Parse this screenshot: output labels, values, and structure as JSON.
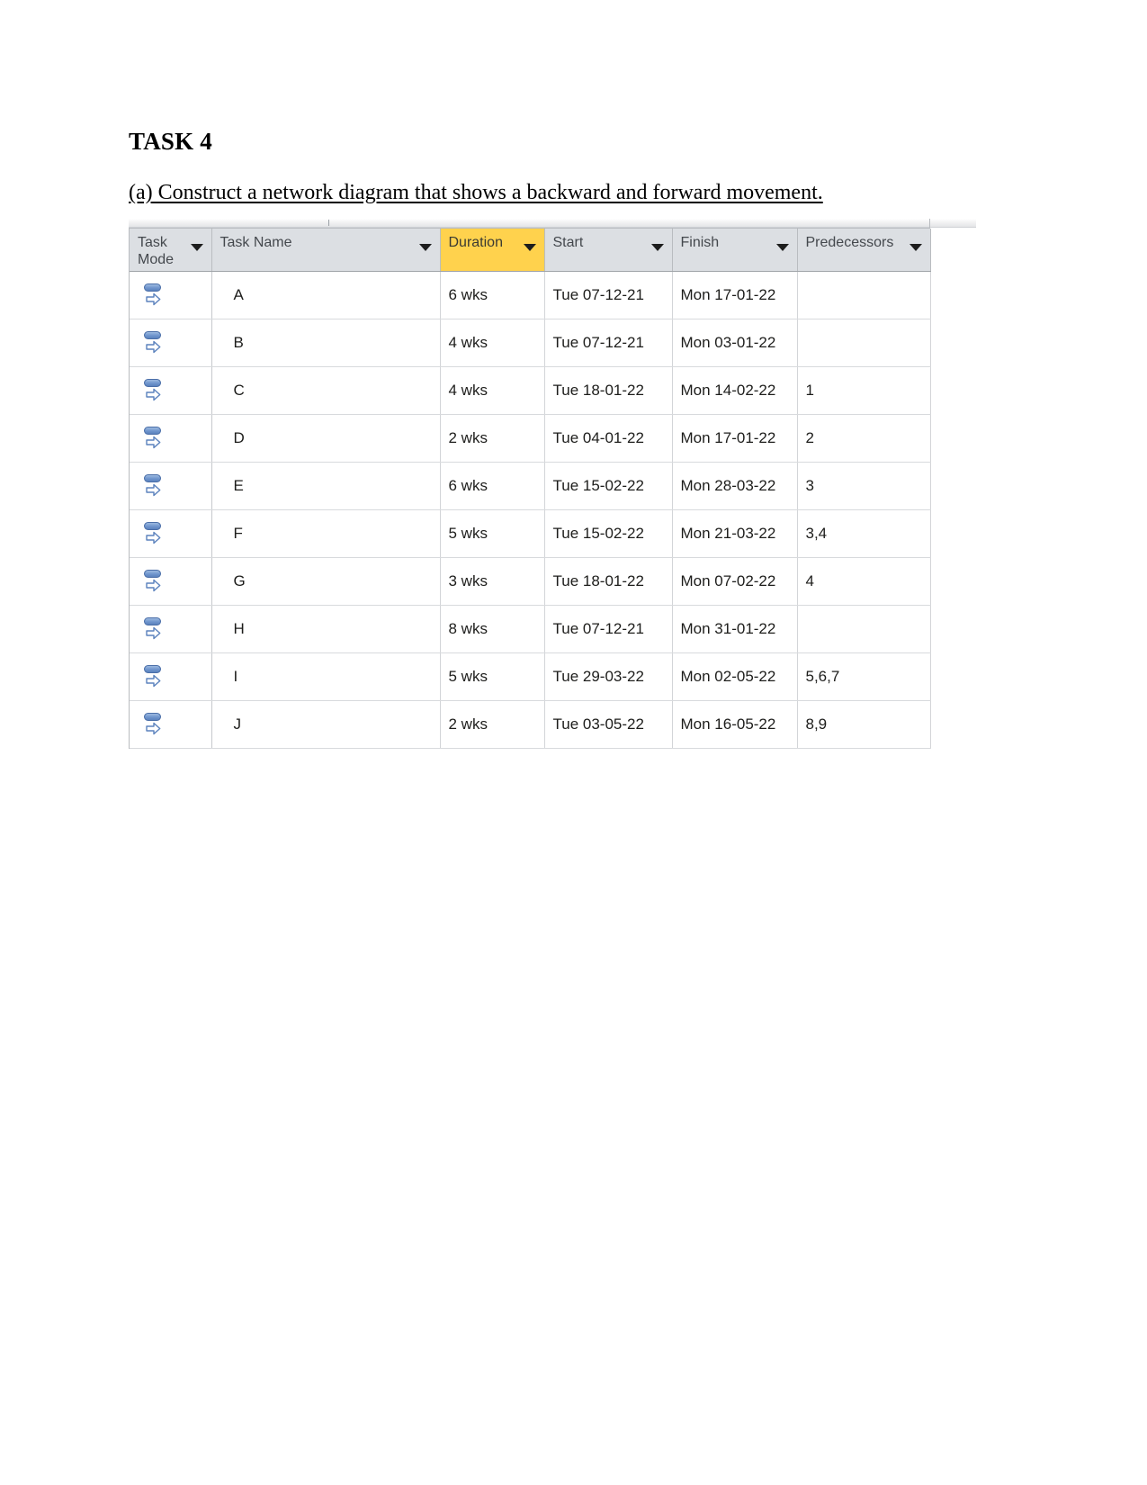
{
  "document": {
    "title": "TASK 4",
    "subtitle": "(a) Construct a network diagram that shows a backward and forward movement."
  },
  "colors": {
    "header_background": "#dcdfe3",
    "header_highlight": "#ffd24d",
    "grid_border": "#b9bcc0",
    "row_border": "#d8dadd",
    "text": "#1d1d1b",
    "header_text": "#44484d",
    "task_mode_icon": "#5b82bd"
  },
  "table": {
    "columns": [
      {
        "key": "mode",
        "label": "Task\nMode",
        "highlighted": false,
        "has_filter": true
      },
      {
        "key": "name",
        "label": "Task Name",
        "highlighted": false,
        "has_filter": true
      },
      {
        "key": "dur",
        "label": "Duration",
        "highlighted": true,
        "has_filter": true
      },
      {
        "key": "start",
        "label": "Start",
        "highlighted": false,
        "has_filter": true
      },
      {
        "key": "finish",
        "label": "Finish",
        "highlighted": false,
        "has_filter": true
      },
      {
        "key": "pred",
        "label": "Predecessors",
        "highlighted": false,
        "has_filter": true
      }
    ],
    "mode_icon_name": "auto-scheduled-task-mode-icon",
    "rows": [
      {
        "mode_icon": "auto-scheduled-task-mode-icon",
        "name": "A",
        "duration": "6 wks",
        "start": "Tue 07-12-21",
        "finish": "Mon 17-01-22",
        "predecessors": ""
      },
      {
        "mode_icon": "auto-scheduled-task-mode-icon",
        "name": "B",
        "duration": "4 wks",
        "start": "Tue 07-12-21",
        "finish": "Mon 03-01-22",
        "predecessors": ""
      },
      {
        "mode_icon": "auto-scheduled-task-mode-icon",
        "name": "C",
        "duration": "4 wks",
        "start": "Tue 18-01-22",
        "finish": "Mon 14-02-22",
        "predecessors": "1"
      },
      {
        "mode_icon": "auto-scheduled-task-mode-icon",
        "name": "D",
        "duration": "2 wks",
        "start": "Tue 04-01-22",
        "finish": "Mon 17-01-22",
        "predecessors": "2"
      },
      {
        "mode_icon": "auto-scheduled-task-mode-icon",
        "name": "E",
        "duration": "6 wks",
        "start": "Tue 15-02-22",
        "finish": "Mon 28-03-22",
        "predecessors": "3"
      },
      {
        "mode_icon": "auto-scheduled-task-mode-icon",
        "name": "F",
        "duration": "5 wks",
        "start": "Tue 15-02-22",
        "finish": "Mon 21-03-22",
        "predecessors": "3,4"
      },
      {
        "mode_icon": "auto-scheduled-task-mode-icon",
        "name": "G",
        "duration": "3 wks",
        "start": "Tue 18-01-22",
        "finish": "Mon 07-02-22",
        "predecessors": "4"
      },
      {
        "mode_icon": "auto-scheduled-task-mode-icon",
        "name": "H",
        "duration": "8 wks",
        "start": "Tue 07-12-21",
        "finish": "Mon 31-01-22",
        "predecessors": ""
      },
      {
        "mode_icon": "auto-scheduled-task-mode-icon",
        "name": "I",
        "duration": "5 wks",
        "start": "Tue 29-03-22",
        "finish": "Mon 02-05-22",
        "predecessors": "5,6,7"
      },
      {
        "mode_icon": "auto-scheduled-task-mode-icon",
        "name": "J",
        "duration": "2 wks",
        "start": "Tue 03-05-22",
        "finish": "Mon 16-05-22",
        "predecessors": "8,9"
      }
    ]
  }
}
